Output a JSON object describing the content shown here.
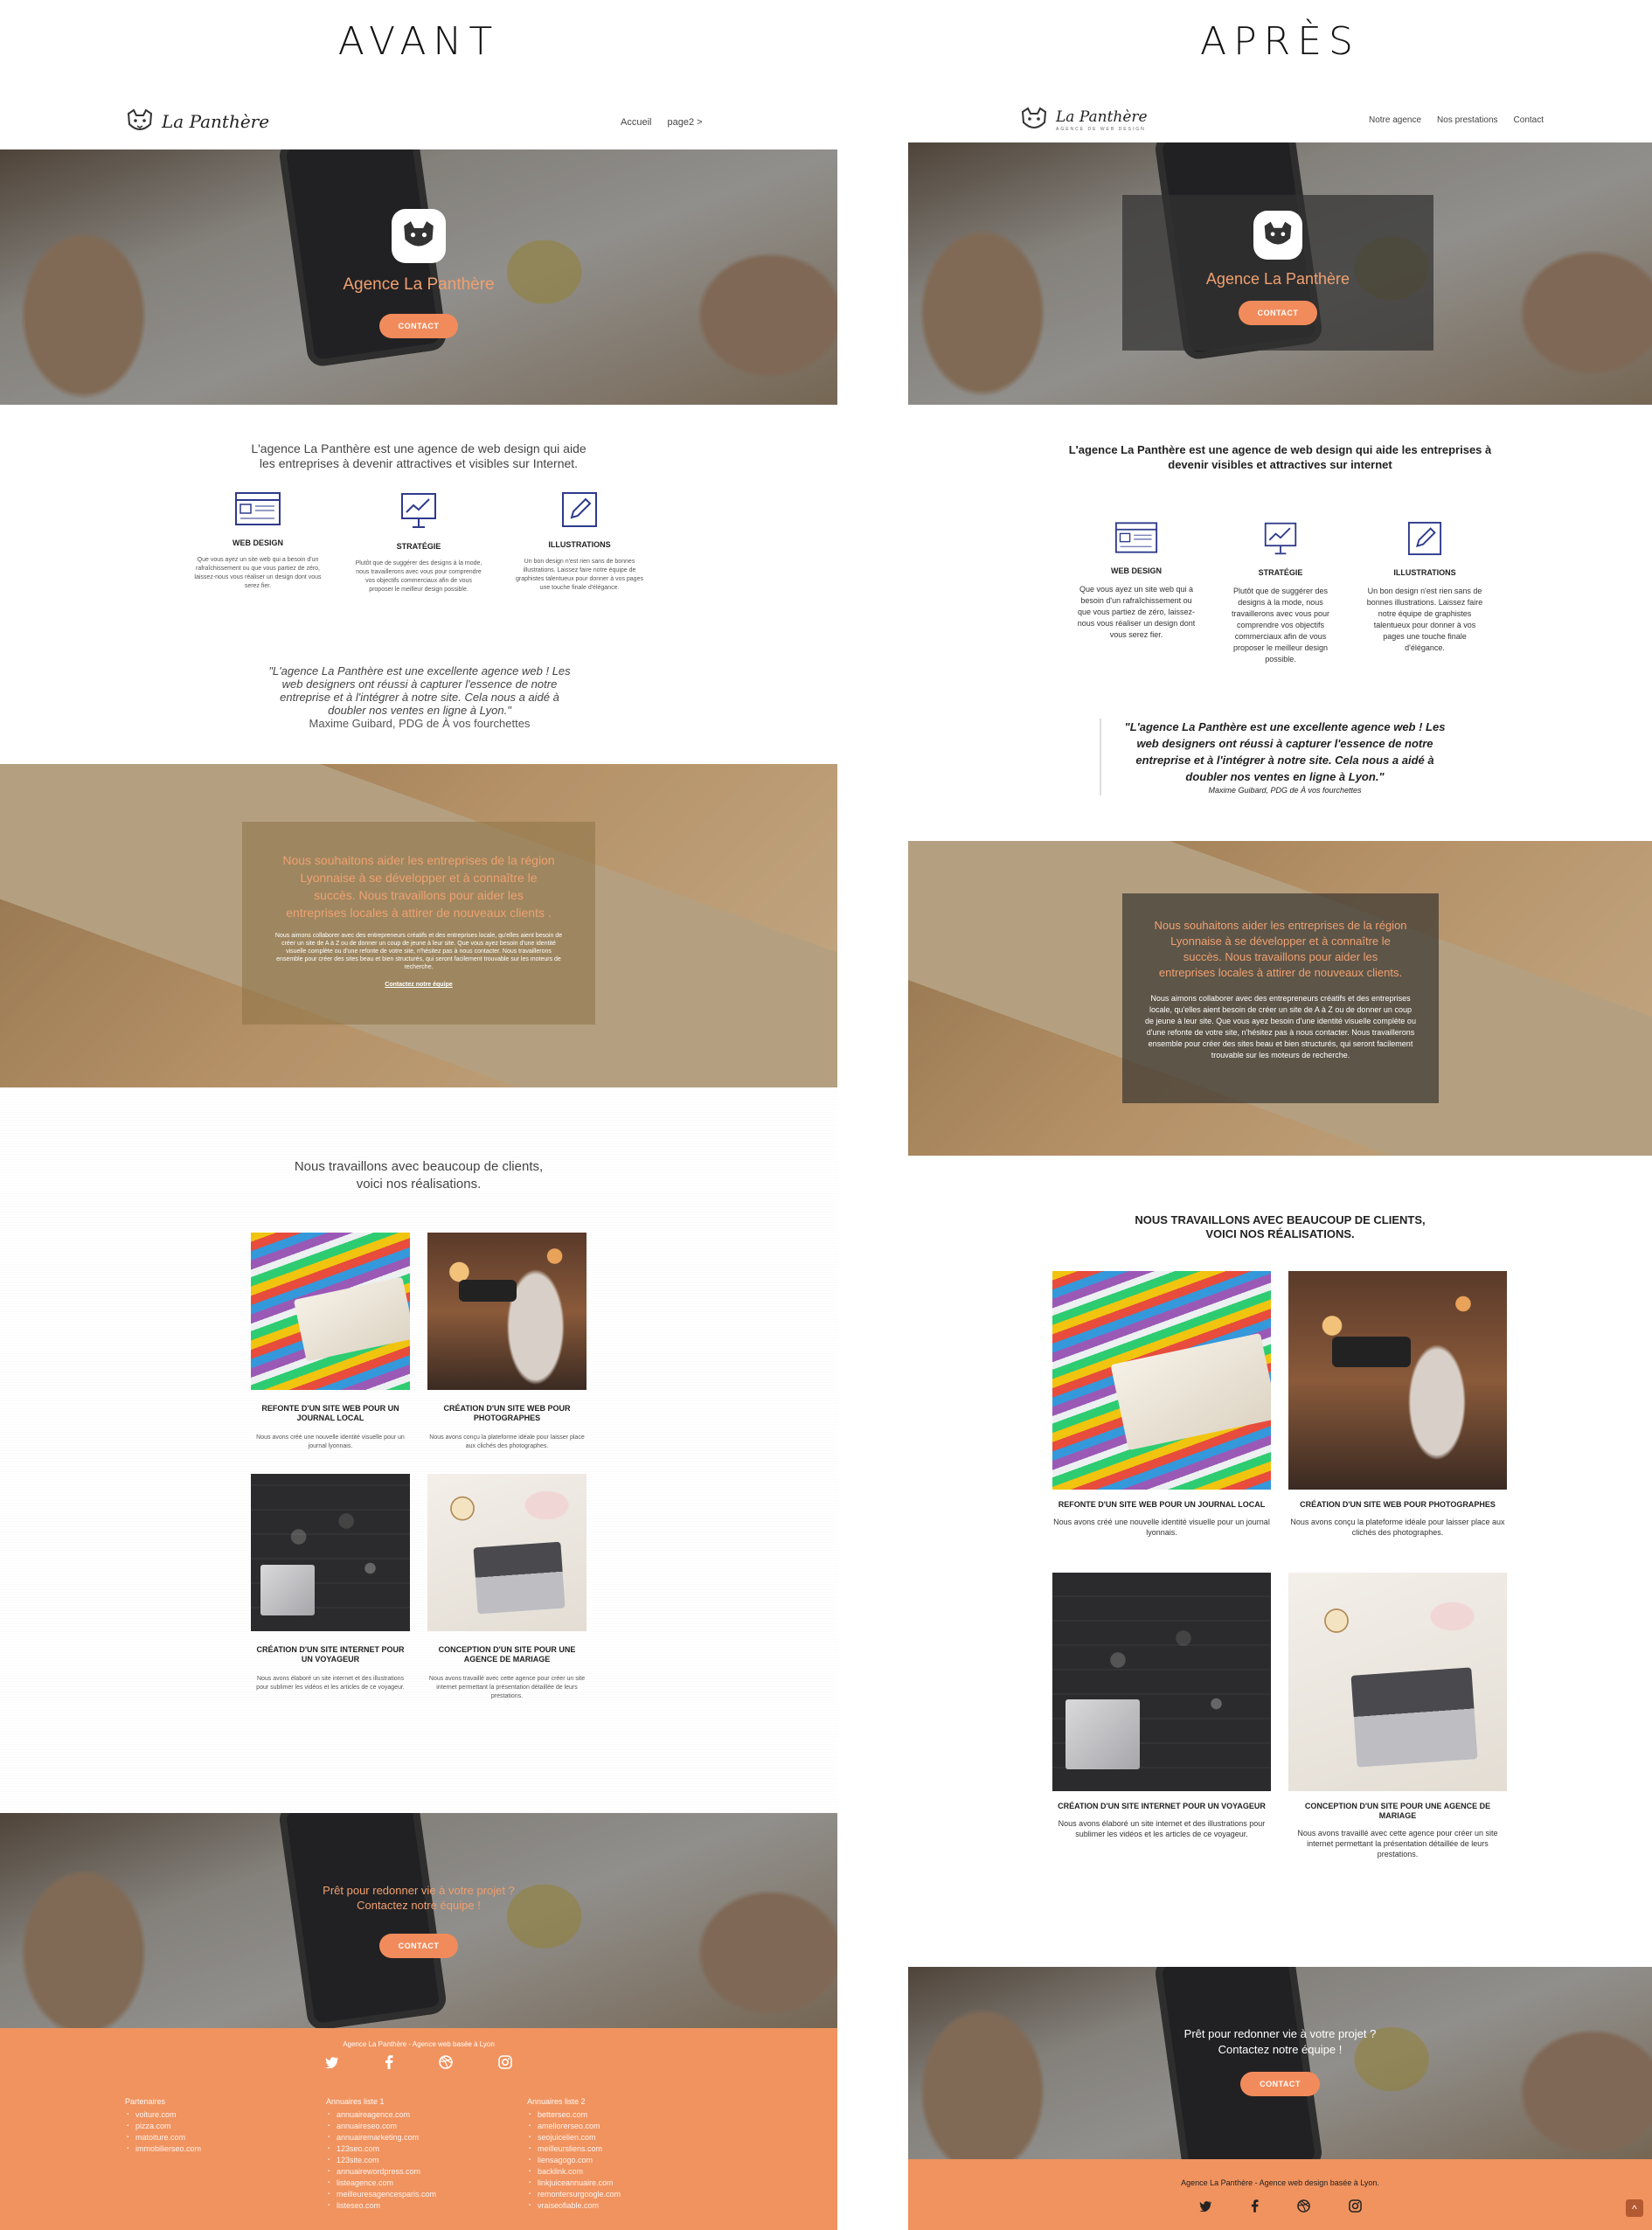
{
  "avant": {
    "heading": "AVANT",
    "nav": {
      "logo_text": "La Panthère",
      "menu": [
        "Accueil",
        "page2 >"
      ]
    },
    "hero": {
      "title": "Agence La Panthère",
      "button": "CONTACT"
    },
    "intro": [
      "L'agence La Panthère est une agence de web design qui aide",
      "les entreprises à devenir attractives et visibles sur Internet."
    ],
    "services": [
      {
        "title": "WEB DESIGN",
        "text": "Que vous ayez un site web qui a besoin d'un rafraîchissement ou que vous partiez de zéro, laissez-nous vous réaliser un design dont vous serez fier."
      },
      {
        "title": "STRATÉGIE",
        "text": "Plutôt que de suggérer des designs à la mode, nous travaillerons avec vous pour comprendre vos objectifs commerciaux afin de vous proposer le meilleur design possible."
      },
      {
        "title": "ILLUSTRATIONS",
        "text": "Un bon design n'est rien sans de bonnes illustrations. Laissez faire notre équipe de graphistes talentueux pour donner à vos pages une touche finale d'élégance."
      }
    ],
    "quote": {
      "lines": [
        "\"L'agence La Panthère est une excellente agence web ! Les",
        "web designers ont réussi à capturer l'essence de notre",
        "entreprise et à l'intégrer à notre site. Cela nous a aidé à",
        "doubler nos ventes en ligne à Lyon.\""
      ],
      "author": "Maxime Guibard, PDG de À vos fourchettes"
    },
    "mission": {
      "headline": [
        "Nous souhaitons aider les entreprises de la région",
        "Lyonnaise à se développer et à connaître le",
        "succès. Nous travaillons pour aider les",
        "entreprises locales à attirer de nouveaux clients ."
      ],
      "body": "Nous aimons collaborer avec des entrepreneurs créatifs et des entreprises locale, qu'elles aient besoin de créer un site de A à Z ou de donner un coup de jeune à leur site. Que vous ayez besoin d'une identité visuelle complète ou d'une refonte de votre site, n'hésitez pas à nous contacter. Nous travaillerons ensemble pour créer des sites beau et bien structurés, qui seront facilement trouvable sur les moteurs de recherche.",
      "link": "Contactez notre équipe"
    },
    "works_title": [
      "Nous travaillons avec beaucoup de clients,",
      "voici nos réalisations."
    ],
    "works": [
      {
        "title": "REFONTE D'UN SITE WEB POUR UN JOURNAL LOCAL",
        "text": "Nous avons créé une nouvelle identité visuelle pour un journal lyonnais."
      },
      {
        "title": "CRÉATION D'UN SITE WEB POUR PHOTOGRAPHES",
        "text": "Nous avons conçu la plateforme idéale pour laisser place aux clichés des photographes."
      },
      {
        "title": "CRÉATION D'UN SITE INTERNET POUR UN VOYAGEUR",
        "text": "Nous avons élaboré un site internet et des illustrations pour sublimer les vidéos et les articles de ce voyageur."
      },
      {
        "title": "CONCEPTION D'UN SITE POUR UNE AGENCE DE MARIAGE",
        "text": "Nous avons travaillé avec cette agence pour créer un site internet permettant la présentation détaillée de leurs prestations."
      }
    ],
    "cta": {
      "lines": [
        "Prêt pour redonner vie à votre projet ?",
        "Contactez notre équipe !"
      ],
      "button": "CONTACT"
    },
    "footer": {
      "tagline": "Agence La Panthère - Agence web basée à Lyon",
      "directories": [
        {
          "heading": "Partenaires",
          "items": [
            "voiture.com",
            "pizza.com",
            "matoiture.com",
            "immobilierseo.com"
          ]
        },
        {
          "heading": "Annuaires liste 1",
          "items": [
            "annuaireagence.com",
            "annuaireseo.com",
            "annuairemarketing.com",
            "123seo.com",
            "123site.com",
            "annuairewordpress.com",
            "listeagence.com",
            "meilleuresagencesparis.com",
            "listeseo.com"
          ]
        },
        {
          "heading": "Annuaires liste 2",
          "items": [
            "betterseo.com",
            "ameliorerseo.com",
            "seojuicelien.com",
            "meilleursliens.com",
            "liensagogo.com",
            "backlink.com",
            "linkjuiceannuaire.com",
            "remontersurgoogle.com",
            "vraiseofiable.com"
          ]
        }
      ]
    }
  },
  "apres": {
    "heading": "APRÈS",
    "nav": {
      "logo_text": "La Panthère",
      "logo_sub": "AGENCE DE WEB DESIGN",
      "menu": [
        "Notre agence",
        "Nos prestations",
        "Contact"
      ]
    },
    "hero": {
      "title": "Agence La Panthère",
      "button": "CONTACT"
    },
    "intro": [
      "L'agence La Panthère est une agence de web design qui aide les entreprises à",
      "devenir visibles et attractives sur internet"
    ],
    "services": [
      {
        "title": "WEB DESIGN",
        "text": "Que vous ayez un site web qui a besoin d'un rafraîchissement ou que vous partiez de zéro, laissez-nous vous réaliser un design dont vous serez fier."
      },
      {
        "title": "STRATÉGIE",
        "text": "Plutôt que de suggérer des designs à la mode, nous travaillerons avec vous pour comprendre vos objectifs commerciaux afin de vous proposer le meilleur design possible."
      },
      {
        "title": "ILLUSTRATIONS",
        "text": "Un bon design n'est rien sans de bonnes illustrations. Laissez faire notre équipe de graphistes talentueux pour donner à vos pages une touche finale d'élégance."
      }
    ],
    "quote": {
      "lines": [
        "\"L'agence La Panthère est une excellente agence web ! Les",
        "web designers ont réussi à capturer l'essence de notre",
        "entreprise et à l'intégrer à notre site. Cela nous a aidé à",
        "doubler nos ventes en ligne à Lyon.\""
      ],
      "author": "Maxime Guibard, PDG de À vos fourchettes"
    },
    "mission": {
      "headline": [
        "Nous souhaitons aider les entreprises de la région",
        "Lyonnaise à se développer et à connaître le",
        "succès. Nous travaillons pour aider les",
        "entreprises locales à attirer de nouveaux clients."
      ],
      "body": "Nous aimons collaborer avec des entrepreneurs créatifs et des entreprises locale, qu'elles aient besoin de créer un site de A à Z ou de donner un coup de jeune à leur site. Que vous ayez besoin d'une identité visuelle complète ou d'une refonte de votre site, n'hésitez pas à nous contacter. Nous travaillerons ensemble pour créer des sites beau et bien structurés, qui seront facilement trouvable sur les moteurs de recherche."
    },
    "works_title": [
      "NOUS TRAVAILLONS AVEC BEAUCOUP DE CLIENTS,",
      "VOICI NOS RÉALISATIONS."
    ],
    "works": [
      {
        "title": "REFONTE D'UN SITE WEB POUR UN JOURNAL LOCAL",
        "text": "Nous avons créé une nouvelle identité visuelle pour un journal lyonnais."
      },
      {
        "title": "CRÉATION D'UN SITE WEB POUR PHOTOGRAPHES",
        "text": "Nous avons conçu la plateforme idéale pour laisser place aux clichés des photographes."
      },
      {
        "title": "CRÉATION D'UN SITE INTERNET POUR UN VOYAGEUR",
        "text": "Nous avons élaboré un site internet et des illustrations pour sublimer les vidéos et les articles de ce voyageur."
      },
      {
        "title": "CONCEPTION D'UN SITE POUR UNE AGENCE DE MARIAGE",
        "text": "Nous avons travaillé avec cette agence pour créer un site internet permettant la présentation détaillée de leurs prestations."
      }
    ],
    "cta": {
      "lines": [
        "Prêt pour redonner vie à votre projet ?",
        "Contactez notre équipe !"
      ],
      "button": "CONTACT"
    },
    "footer": {
      "tagline": "Agence La Panthère - Agence web design basée à Lyon.",
      "scroll_top": "^"
    }
  },
  "icons": {
    "social": [
      "twitter-icon",
      "facebook-icon",
      "dribbble-icon",
      "instagram-icon"
    ],
    "services": [
      "browser-window-icon",
      "presentation-chart-icon",
      "pencil-icon"
    ]
  },
  "colors": {
    "accent": "#f28b5b",
    "footer": "#f0935f",
    "hero_title": "#f0a070",
    "dark_overlay": "#3a3a3a"
  }
}
